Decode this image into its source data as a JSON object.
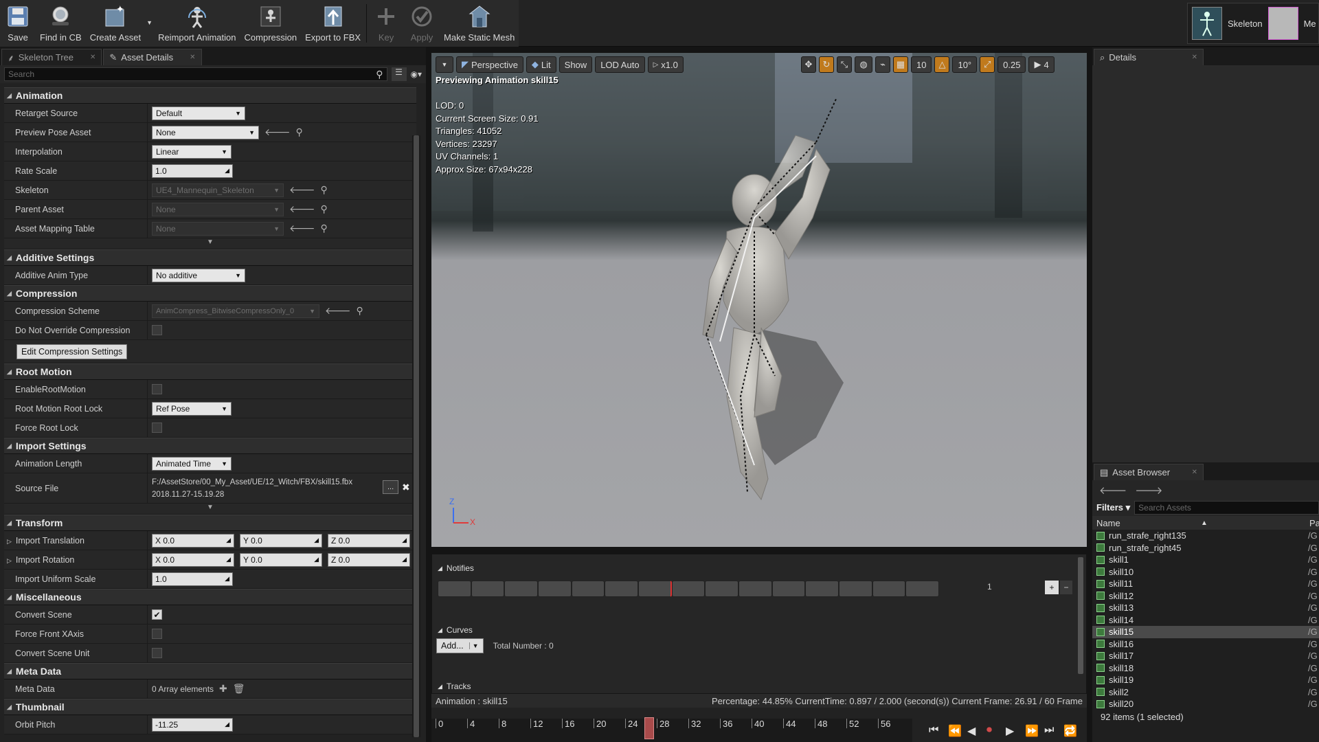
{
  "toolbar": {
    "buttons": [
      {
        "label": "Save",
        "icon": "save-icon",
        "dim": false
      },
      {
        "label": "Find in CB",
        "icon": "find-icon",
        "dim": false
      },
      {
        "label": "Create Asset",
        "icon": "create-asset-icon",
        "dim": false
      },
      {
        "label": "Reimport Animation",
        "icon": "reimport-icon",
        "dim": false
      },
      {
        "label": "Compression",
        "icon": "compression-icon",
        "dim": false
      },
      {
        "label": "Export to FBX",
        "icon": "export-icon",
        "dim": false
      },
      {
        "label": "Key",
        "icon": "key-plus-icon",
        "dim": true
      },
      {
        "label": "Apply",
        "icon": "apply-check-icon",
        "dim": true
      },
      {
        "label": "Make Static Mesh",
        "icon": "static-mesh-icon",
        "dim": false
      }
    ],
    "mode_skeleton": "Skeleton",
    "mode_mesh": "Me"
  },
  "left_tabs": [
    {
      "label": "Skeleton Tree"
    },
    {
      "label": "Asset Details"
    }
  ],
  "search": {
    "placeholder": "Search"
  },
  "animation": {
    "title": "Animation",
    "retarget_source": {
      "label": "Retarget Source",
      "value": "Default"
    },
    "preview_pose": {
      "label": "Preview Pose Asset",
      "value": "None"
    },
    "interpolation": {
      "label": "Interpolation",
      "value": "Linear"
    },
    "rate_scale": {
      "label": "Rate Scale",
      "value": "1.0"
    },
    "skeleton": {
      "label": "Skeleton",
      "value": "UE4_Mannequin_Skeleton"
    },
    "parent_asset": {
      "label": "Parent Asset",
      "value": "None"
    },
    "mapping_table": {
      "label": "Asset Mapping Table",
      "value": "None"
    }
  },
  "additive": {
    "title": "Additive Settings",
    "label": "Additive Anim Type",
    "value": "No additive"
  },
  "compression": {
    "title": "Compression",
    "scheme_label": "Compression Scheme",
    "scheme_value": "AnimCompress_BitwiseCompressOnly_0",
    "override_label": "Do Not Override Compression",
    "edit_button": "Edit Compression Settings"
  },
  "root_motion": {
    "title": "Root Motion",
    "enable_label": "EnableRootMotion",
    "lock_label": "Root Motion Root Lock",
    "lock_value": "Ref Pose",
    "force_label": "Force Root Lock"
  },
  "import": {
    "title": "Import Settings",
    "length_label": "Animation Length",
    "length_value": "Animated Time",
    "source_label": "Source File",
    "source_path": "F:/AssetStore/00_My_Asset/UE/12_Witch/FBX/skill15.fbx",
    "source_date": "2018.11.27-15.19.28",
    "browse": "..."
  },
  "transform": {
    "title": "Transform",
    "translation_label": "Import Translation",
    "rotation_label": "Import Rotation",
    "scale_label": "Import Uniform Scale",
    "x": "X  0.0",
    "y": "Y  0.0",
    "z": "Z  0.0",
    "scale": "1.0"
  },
  "misc": {
    "title": "Miscellaneous",
    "convert_scene": "Convert Scene",
    "force_front": "Force Front XAxis",
    "convert_unit": "Convert Scene Unit"
  },
  "meta": {
    "title": "Meta Data",
    "label": "Meta Data",
    "value": "0 Array elements"
  },
  "thumbnail": {
    "title": "Thumbnail",
    "pitch_label": "Orbit Pitch",
    "pitch_value": "-11.25"
  },
  "viewport": {
    "perspective": "Perspective",
    "lit": "Lit",
    "show": "Show",
    "lod": "LOD Auto",
    "speed": "x1.0",
    "grid": "10",
    "angle": "10°",
    "scale": "0.25",
    "cam": "4",
    "title": "Previewing Animation skill15",
    "stats": [
      "LOD: 0",
      "Current Screen Size: 0.91",
      "Triangles: 41052",
      "Vertices: 23297",
      "UV Channels: 1",
      "Approx Size: 67x94x228"
    ],
    "axis_z": "Z",
    "axis_x": "X"
  },
  "timeline": {
    "notifies": "Notifies",
    "track_num": "1",
    "curves": "Curves",
    "add": "Add...",
    "total": "Total Number : 0",
    "tracks": "Tracks"
  },
  "status": {
    "animation": "Animation :  skill15",
    "percentage": "Percentage:  44.85%  CurrentTime:  0.897 / 2.000 (second(s)) Current Frame:  26.91 / 60 Frame"
  },
  "ruler": [
    "0",
    "4",
    "8",
    "12",
    "16",
    "20",
    "24",
    "28",
    "32",
    "36",
    "40",
    "44",
    "48",
    "52",
    "56"
  ],
  "details_tab": "Details",
  "asset_browser": {
    "tab": "Asset Browser",
    "filters": "Filters",
    "search_placeholder": "Search Assets",
    "col_name": "Name",
    "col_path": "Pa",
    "items": [
      {
        "name": "run_strafe_right135",
        "path": "/G"
      },
      {
        "name": "run_strafe_right45",
        "path": "/G"
      },
      {
        "name": "skill1",
        "path": "/G"
      },
      {
        "name": "skill10",
        "path": "/G"
      },
      {
        "name": "skill11",
        "path": "/G"
      },
      {
        "name": "skill12",
        "path": "/G"
      },
      {
        "name": "skill13",
        "path": "/G"
      },
      {
        "name": "skill14",
        "path": "/G"
      },
      {
        "name": "skill15",
        "path": "/G"
      },
      {
        "name": "skill16",
        "path": "/G"
      },
      {
        "name": "skill17",
        "path": "/G"
      },
      {
        "name": "skill18",
        "path": "/G"
      },
      {
        "name": "skill19",
        "path": "/G"
      },
      {
        "name": "skill2",
        "path": "/G"
      },
      {
        "name": "skill20",
        "path": "/G"
      }
    ],
    "count": "92 items (1 selected)"
  }
}
